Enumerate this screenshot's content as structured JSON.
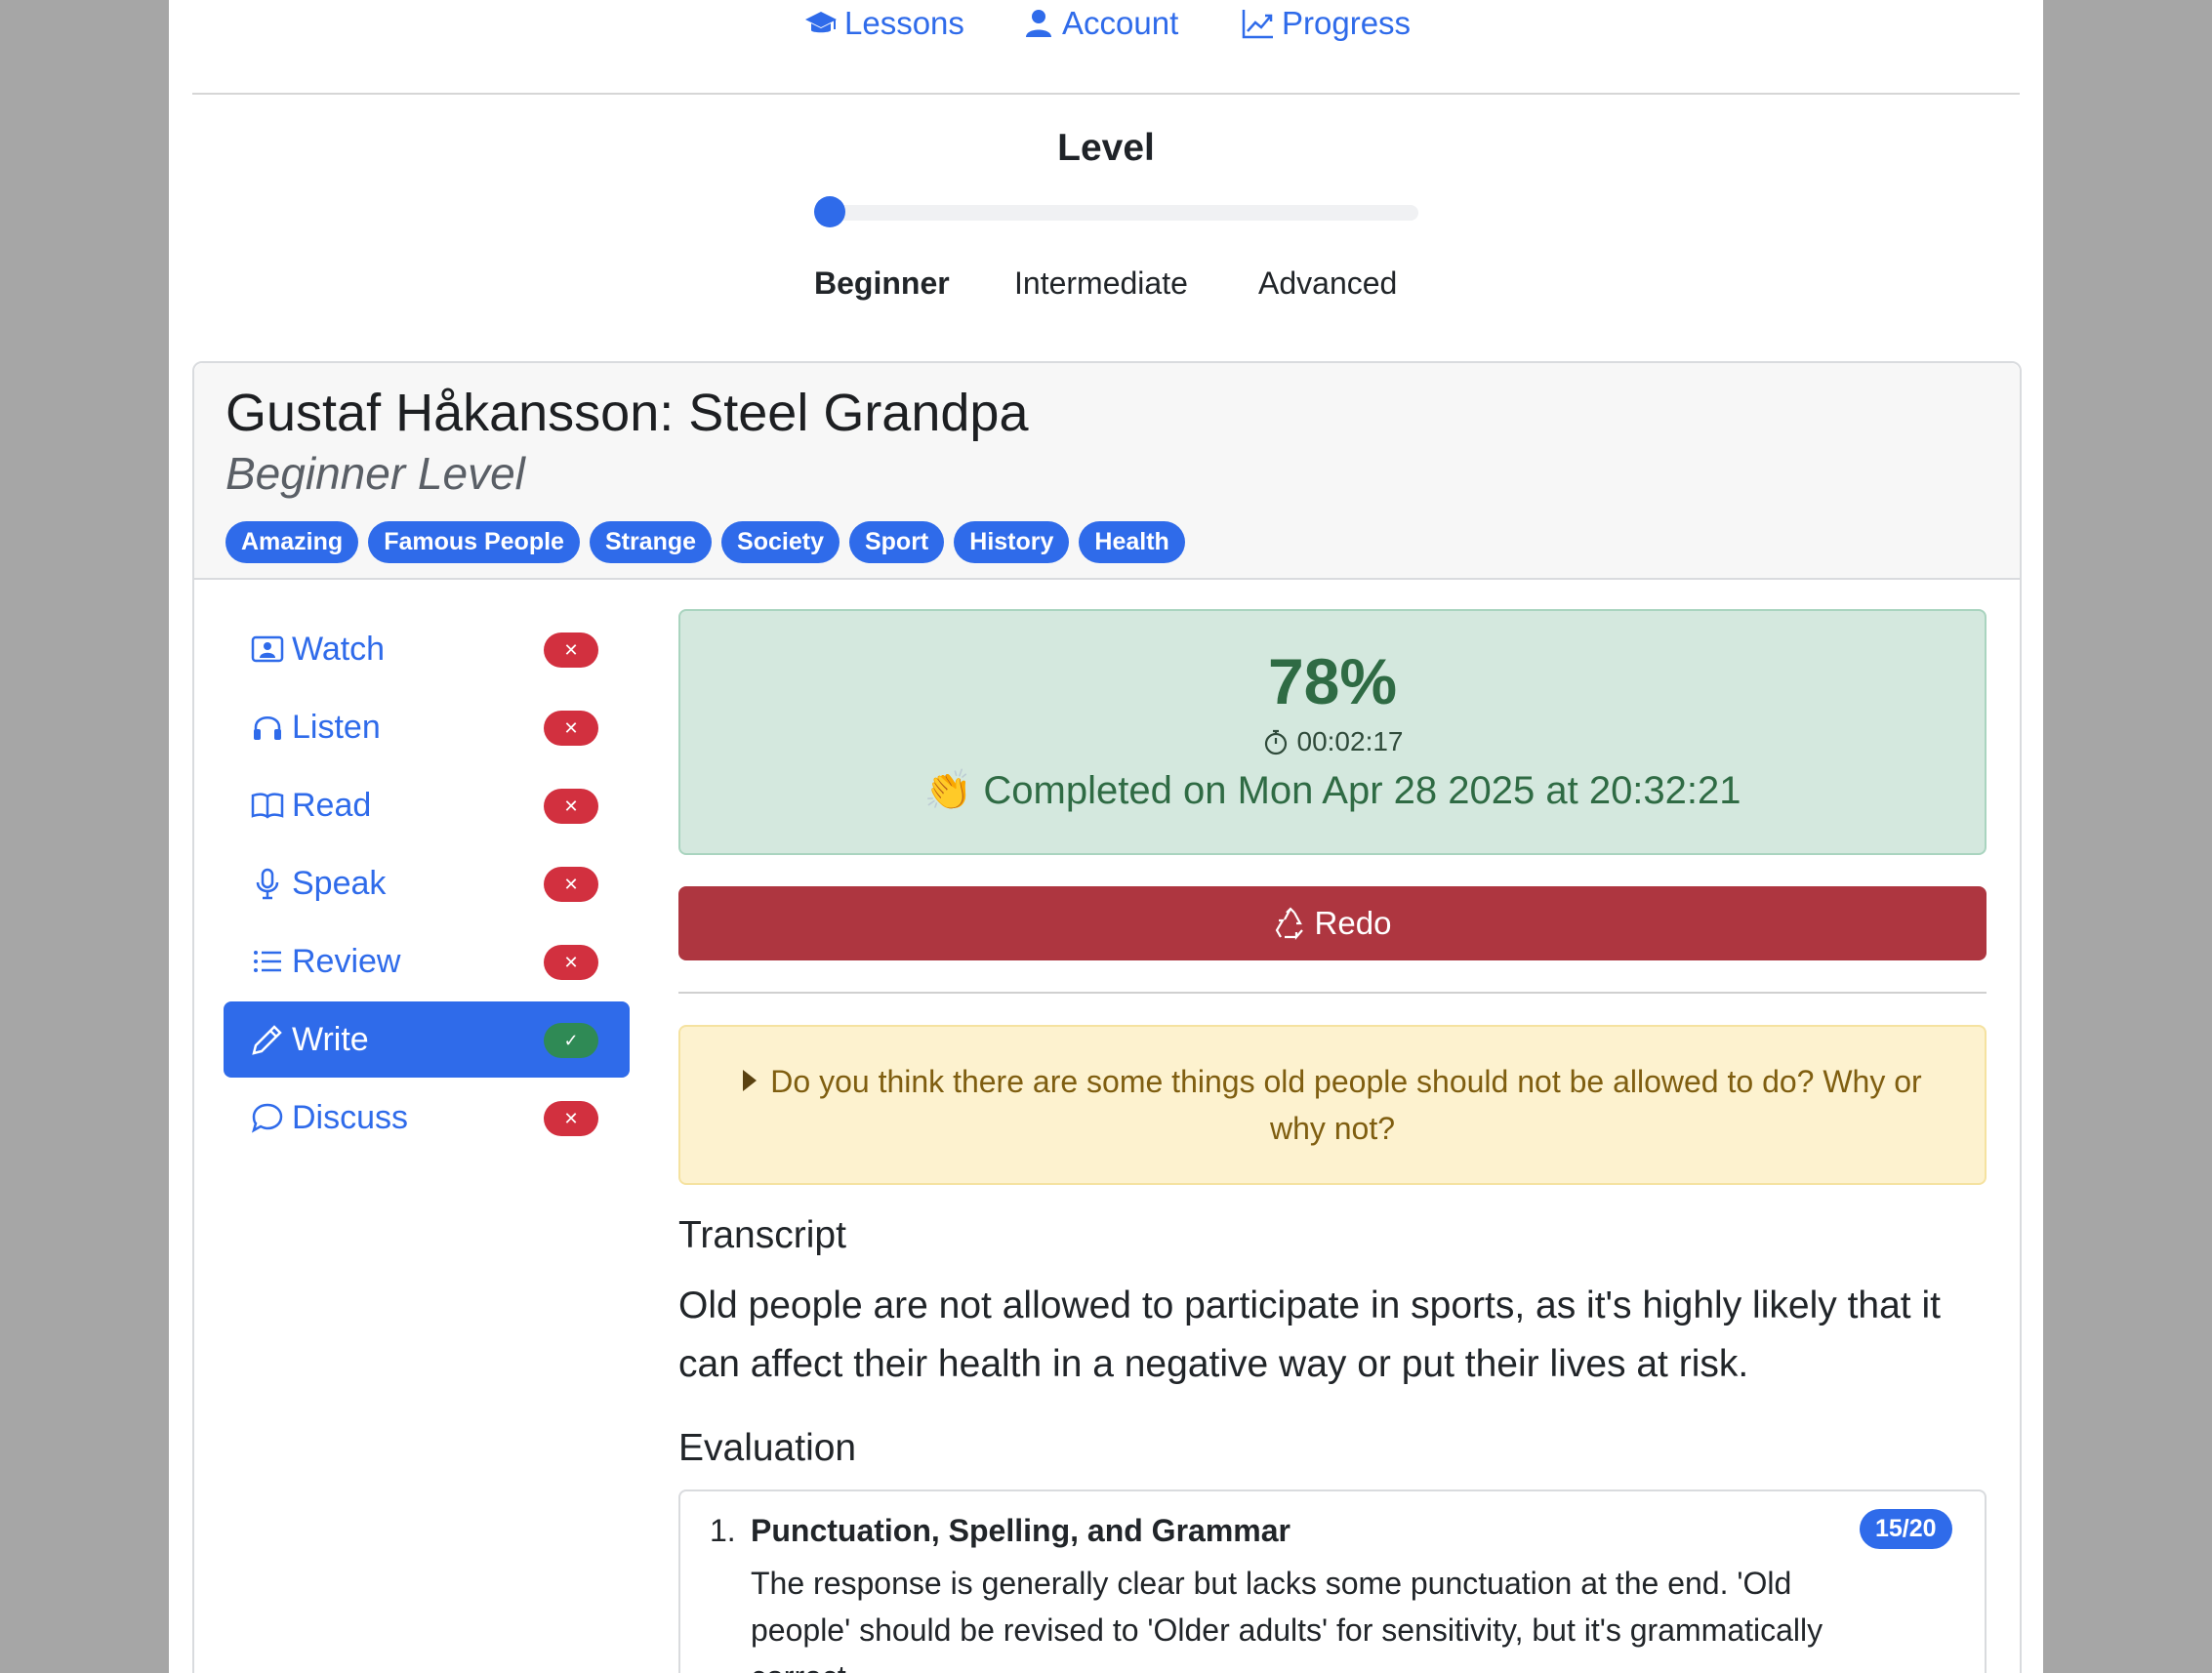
{
  "nav": {
    "lessons": "Lessons",
    "account": "Account",
    "progress": "Progress"
  },
  "level": {
    "title": "Level",
    "options": [
      "Beginner",
      "Intermediate",
      "Advanced"
    ],
    "selected_index": 0
  },
  "lesson": {
    "title": "Gustaf Håkansson: Steel Grandpa",
    "subtitle": "Beginner Level",
    "tags": [
      "Amazing",
      "Famous People",
      "Strange",
      "Society",
      "Sport",
      "History",
      "Health"
    ]
  },
  "sidebar": {
    "items": [
      {
        "label": "Watch",
        "icon": "video-icon",
        "done": false
      },
      {
        "label": "Listen",
        "icon": "headphones-icon",
        "done": false
      },
      {
        "label": "Read",
        "icon": "book-icon",
        "done": false
      },
      {
        "label": "Speak",
        "icon": "mic-icon",
        "done": false
      },
      {
        "label": "Review",
        "icon": "list-icon",
        "done": false
      },
      {
        "label": "Write",
        "icon": "pencil-icon",
        "done": true,
        "active": true
      },
      {
        "label": "Discuss",
        "icon": "chat-icon",
        "done": false
      }
    ]
  },
  "result": {
    "percent": "78%",
    "duration": "00:02:17",
    "completed_text": "Completed on Mon Apr 28 2025 at 20:32:21",
    "completed_emoji": "👏"
  },
  "redo_label": "Redo",
  "prompt": "Do you think there are some things old people should not be allowed to do? Why or why not?",
  "transcript": {
    "heading": "Transcript",
    "text": "Old people are not allowed to participate in sports, as it's highly likely that it can affect their health in a negative way or put their lives at risk."
  },
  "evaluation": {
    "heading": "Evaluation",
    "items": [
      {
        "number": "1.",
        "title": "Punctuation, Spelling, and Grammar",
        "score": "15/20",
        "body": "The response is generally clear but lacks some punctuation at the end. 'Old people' should be revised to 'Older adults' for sensitivity, but it's grammatically correct."
      }
    ]
  },
  "colors": {
    "primary": "#2f6bea",
    "danger": "#ae3640",
    "success_bg": "#d4e8de",
    "warning_bg": "#fdf2cf"
  }
}
